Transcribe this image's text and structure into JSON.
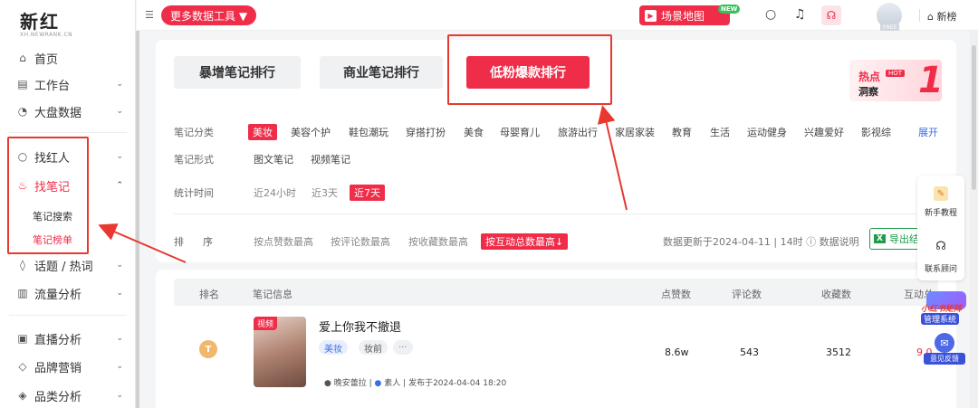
{
  "logo": {
    "main": "新红",
    "sub": "XH.NEWRANK.CN"
  },
  "sidebar": {
    "items": [
      {
        "label": "首页",
        "icon": "home-icon",
        "glyph": "⌂"
      },
      {
        "label": "工作台",
        "icon": "workbench-icon",
        "glyph": "▤"
      },
      {
        "label": "大盘数据",
        "icon": "dashboard-icon",
        "glyph": "◔"
      },
      {
        "label": "找红人",
        "icon": "search-icon",
        "glyph": "○"
      },
      {
        "label": "找笔记",
        "icon": "note-icon",
        "glyph": "♨"
      },
      {
        "label": "话题 / 热词",
        "icon": "topic-icon",
        "glyph": "◊"
      },
      {
        "label": "流量分析",
        "icon": "traffic-icon",
        "glyph": "▥"
      },
      {
        "label": "直播分析",
        "icon": "live-icon",
        "glyph": "▣"
      },
      {
        "label": "品牌营销",
        "icon": "brand-icon",
        "glyph": "◇"
      },
      {
        "label": "品类分析",
        "icon": "category-icon",
        "glyph": "◈"
      }
    ],
    "sub_items": [
      "笔记搜索",
      "笔记榜单"
    ]
  },
  "topbar": {
    "tools_label": "更多数据工具 ▼",
    "scene_label": "场景地图",
    "new_badge": "NEW",
    "free_tag": "FREE",
    "newlist_label": "新榜"
  },
  "tabs": [
    "暴增笔记排行",
    "商业笔记排行",
    "低粉爆款排行"
  ],
  "hot": {
    "title": "热点",
    "badge": "HOT",
    "sub": "洞察",
    "num": "1"
  },
  "filters": {
    "category_label": "笔记分类",
    "categories": [
      "美妆",
      "美容个护",
      "鞋包潮玩",
      "穿搭打扮",
      "美食",
      "母婴育儿",
      "旅游出行",
      "家居家装",
      "教育",
      "生活",
      "运动健身",
      "兴趣爱好",
      "影视综"
    ],
    "expand": "展开",
    "form_label": "笔记形式",
    "forms": [
      "图文笔记",
      "视频笔记"
    ],
    "time_label": "统计时间",
    "times": [
      "近24小时",
      "近3天",
      "近7天"
    ],
    "sort_label_1": "排",
    "sort_label_2": "序",
    "sorts": [
      "按点赞数最高",
      "按评论数最高",
      "按收藏数最高",
      "按互动总数最高↓"
    ]
  },
  "update_text": "数据更新于2024-04-11 | 14时 ⓘ 数据说明",
  "export_label": "导出结",
  "table": {
    "headers": [
      "排名",
      "笔记信息",
      "点赞数",
      "评论数",
      "收藏数",
      "互动总"
    ],
    "row": {
      "rank": "T",
      "video_tag": "视频",
      "title": "爱上你我不撤退",
      "tags": [
        "美妆",
        "妆前",
        "···"
      ],
      "author": "晚安蕾拉",
      "author_type": "素人",
      "published": "发布于2024-04-04 18:20",
      "likes": "8.6w",
      "comments": "543",
      "favorites": "3512",
      "interactions": "9.0"
    }
  },
  "float": {
    "tutorial": "新手教程",
    "contact": "联系顾问"
  },
  "promo": {
    "line1": "小红书矩阵",
    "line2": "管理系统"
  },
  "feedback": "意见反馈"
}
